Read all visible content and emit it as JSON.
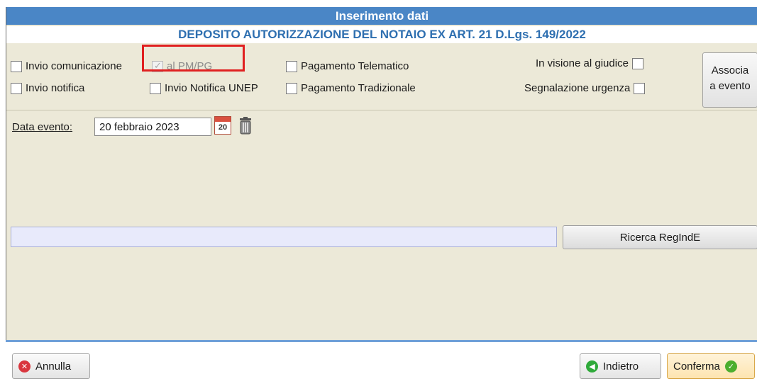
{
  "window": {
    "title": "Inserimento dati",
    "subtitle": "DEPOSITO AUTORIZZAZIONE DEL NOTAIO EX ART. 21 D.Lgs. 149/2022"
  },
  "options": {
    "invio_comunicazione": {
      "label": "Invio comunicazione",
      "checked": false
    },
    "al_pm_pg": {
      "label": "al PM/PG",
      "checked": true,
      "disabled": true
    },
    "pagamento_telematico": {
      "label": "Pagamento Telematico",
      "checked": false
    },
    "in_visione_giudice": {
      "label": "In visione al giudice",
      "checked": false
    },
    "invio_notifica": {
      "label": "Invio notifica",
      "checked": false
    },
    "invio_notifica_unep": {
      "label": "Invio Notifica UNEP",
      "checked": false
    },
    "pagamento_tradizionale": {
      "label": "Pagamento Tradizionale",
      "checked": false
    },
    "segnalazione_urgenza": {
      "label": "Segnalazione urgenza",
      "checked": false
    }
  },
  "associa_button": {
    "line1": "Associa",
    "line2": "a evento"
  },
  "data_evento": {
    "label": "Data evento:",
    "value": "20 febbraio 2023",
    "calendar_day": "20"
  },
  "search": {
    "value": "",
    "button_label": "Ricerca RegIndE"
  },
  "footer": {
    "annulla_label": "Annulla",
    "indietro_label": "Indietro",
    "conferma_label": "Conferma"
  },
  "colors": {
    "title_bar": "#4a86c6",
    "subtitle_text": "#2e6fb0",
    "panel_bg": "#ece9d8",
    "highlight_box": "#e02020",
    "annulla_icon": "#d9363e",
    "indietro_icon": "#2faa3a",
    "conferma_icon": "#4cae2e"
  },
  "icons": {
    "calendar": "calendar-icon",
    "trash": "trash-icon",
    "annulla": "cancel-circle-icon",
    "indietro": "back-arrow-circle-icon",
    "conferma": "check-circle-icon"
  }
}
